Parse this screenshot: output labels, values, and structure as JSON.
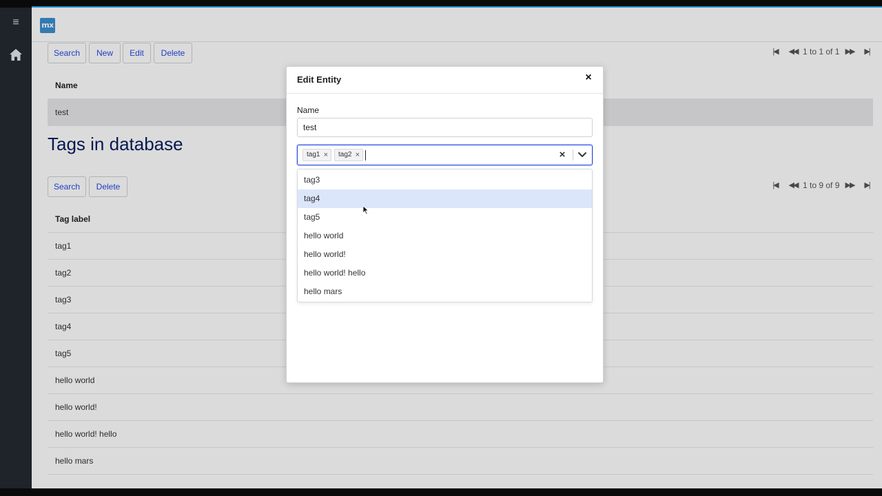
{
  "app": {
    "logo_text": "mx",
    "brand_color": "#3b8fd0",
    "accent_color": "#264ae5"
  },
  "sidebar": {
    "menu_icon": "hamburger-menu-icon",
    "menu_glyph": "≡",
    "home_icon": "home-icon"
  },
  "entity_grid": {
    "toolbar": {
      "search": "Search",
      "new": "New",
      "edit": "Edit",
      "delete": "Delete"
    },
    "pager_text": "1 to 1 of 1",
    "column_header": "Name",
    "rows": [
      "test"
    ]
  },
  "tags_section": {
    "title": "Tags in database",
    "toolbar": {
      "search": "Search",
      "delete": "Delete"
    },
    "pager_text": "1 to 9 of 9",
    "column_header": "Tag label",
    "rows": [
      "tag1",
      "tag2",
      "tag3",
      "tag4",
      "tag5",
      "hello world",
      "hello world!",
      "hello world! hello",
      "hello mars"
    ]
  },
  "modal": {
    "title": "Edit Entity",
    "close_glyph": "×",
    "name_label": "Name",
    "name_value": "test",
    "selected_tags": [
      "tag1",
      "tag2"
    ],
    "chip_remove_glyph": "×",
    "clear_glyph": "×",
    "dropdown_options": [
      "tag3",
      "tag4",
      "tag5",
      "hello world",
      "hello world!",
      "hello world! hello",
      "hello mars"
    ],
    "highlighted_option": "tag4"
  }
}
